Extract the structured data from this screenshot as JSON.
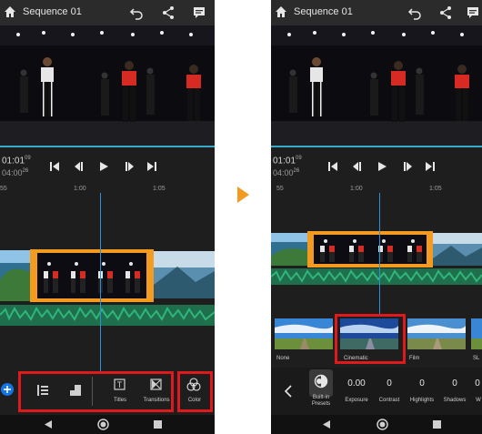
{
  "left": {
    "title": "Sequence 01",
    "timecode": "01:01",
    "timecode_frames": "09",
    "duration": "04:00",
    "duration_frames": "26",
    "ruler": [
      "55",
      "1:00",
      "1:05"
    ],
    "tools": {
      "titles": "Titles",
      "transitions": "Transitions",
      "color": "Color"
    }
  },
  "right": {
    "title": "Sequence 01",
    "timecode": "01:01",
    "timecode_frames": "09",
    "duration": "04:00",
    "duration_frames": "26",
    "ruler": [
      "55",
      "1:00",
      "1:05"
    ],
    "presets": [
      "None",
      "Cinematic",
      "Film",
      "SL"
    ],
    "adjust": {
      "builtin": "Built-in Presets",
      "exposure_value": "0.00",
      "exposure": "Exposure",
      "contrast_value": "0",
      "contrast": "Contrast",
      "highlights_value": "0",
      "highlights": "Highlights",
      "shadows_value": "0",
      "shadows": "Shadows",
      "extra_value": "0",
      "extra": "W"
    }
  },
  "colors": {
    "accent_orange": "#f39a20",
    "highlight_red": "#e0191d",
    "playhead_blue": "#2f8fd9",
    "audio_green": "#2fb67a"
  }
}
